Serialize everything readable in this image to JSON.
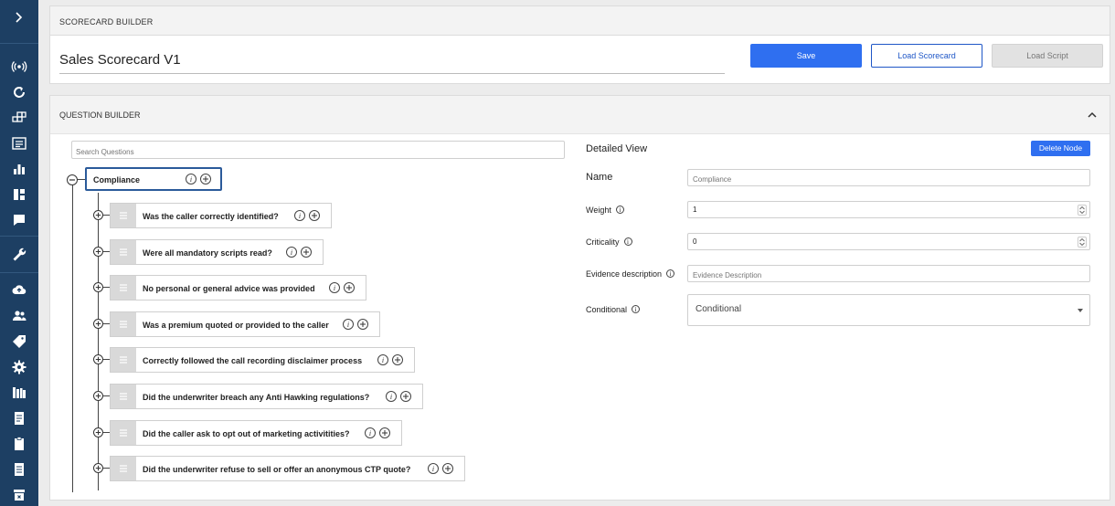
{
  "scorecard_builder": {
    "header": "SCORECARD BUILDER",
    "name": "Sales Scorecard V1",
    "save_label": "Save",
    "load_scorecard_label": "Load Scorecard",
    "load_script_label": "Load Script"
  },
  "question_builder": {
    "header": "QUESTION BUILDER",
    "search_placeholder": "Search Questions",
    "root": {
      "label": "Compliance"
    },
    "questions": [
      "Was the caller correctly identified?",
      "Were all mandatory scripts read?",
      "No personal or general advice was provided",
      "Was a premium quoted or provided to the caller",
      "Correctly followed the call recording disclaimer process",
      "Did the underwriter breach any Anti Hawking regulations?",
      "Did the caller ask to opt out of marketing activitities?",
      "Did the underwriter refuse to sell or offer an anonymous CTP quote?"
    ]
  },
  "detail_view": {
    "title": "Detailed View",
    "delete_label": "Delete Node",
    "name_label": "Name",
    "name_placeholder": "Compliance",
    "weight_label": "Weight",
    "weight_value": "1",
    "criticality_label": "Criticality",
    "criticality_value": "0",
    "evidence_label": "Evidence description",
    "evidence_placeholder": "Evidence Description",
    "conditional_label": "Conditional",
    "conditional_value": "Conditional"
  },
  "sidebar": {
    "icons": [
      "broadcast-icon",
      "refresh-icon",
      "modules-icon",
      "list-icon",
      "bar-chart-icon",
      "dashboard-icon",
      "chat-icon",
      "wrench-icon",
      "cloud-upload-icon",
      "users-icon",
      "tag-icon",
      "settings-icon",
      "library-icon",
      "document-icon",
      "clipboard-icon",
      "file-icon",
      "archive-icon"
    ]
  },
  "colors": {
    "sidebar": "#1d3f63",
    "primary": "#2f6ff0",
    "root_border": "#2b5a9a"
  }
}
